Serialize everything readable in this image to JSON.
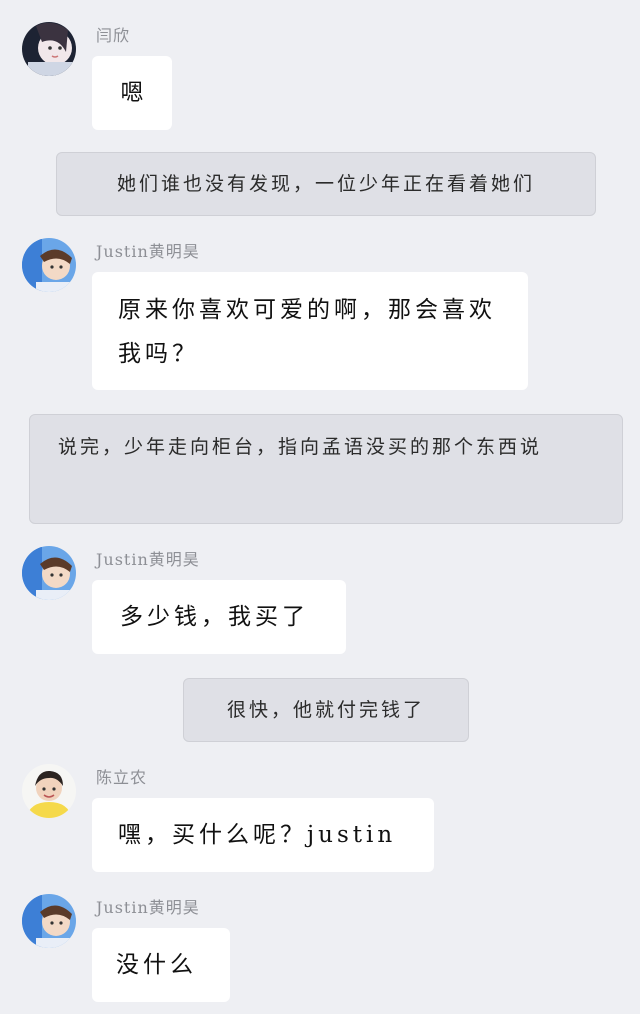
{
  "messages": [
    {
      "sender": "闫欣",
      "text": "嗯"
    },
    {
      "narration": "她们谁也没有发现，一位少年正在看着她们"
    },
    {
      "sender": "Justin黄明昊",
      "text": "原来你喜欢可爱的啊，那会喜欢我吗？"
    },
    {
      "narration": "说完，少年走向柜台，指向孟语没买的那个东西说"
    },
    {
      "sender": "Justin黄明昊",
      "text": "多少钱，我买了"
    },
    {
      "narration": "很快，他就付完钱了"
    },
    {
      "sender": "陈立农",
      "text": "嘿，买什么呢？justin"
    },
    {
      "sender": "Justin黄明昊",
      "text": "没什么"
    }
  ],
  "colors": {
    "background": "#eeeff3",
    "bubble": "#ffffff",
    "narration": "#dfe0e6",
    "sender_text": "#8d8f95"
  }
}
